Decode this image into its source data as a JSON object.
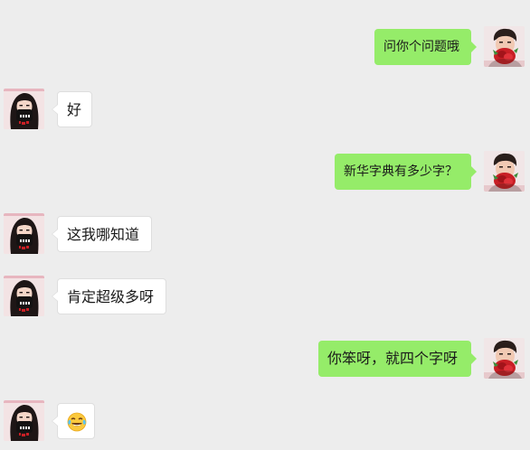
{
  "chat": {
    "messages": [
      {
        "sender": "me",
        "text": "问你个问题哦"
      },
      {
        "sender": "other",
        "text": "好"
      },
      {
        "sender": "me",
        "text": "新华字典有多少字？"
      },
      {
        "sender": "other",
        "text": "这我哪知道"
      },
      {
        "sender": "other",
        "text": "肯定超级多呀"
      },
      {
        "sender": "me",
        "text": "你笨呀，就四个字呀"
      },
      {
        "sender": "other",
        "emoji": "tears-of-joy-emoji"
      }
    ]
  },
  "icons": {
    "me_avatar": "avatar-boy-with-red-mask",
    "other_avatar": "avatar-girl-with-black-mask"
  },
  "colors": {
    "background": "#ededed",
    "sent_bubble": "#95ec69",
    "received_bubble": "#ffffff"
  }
}
